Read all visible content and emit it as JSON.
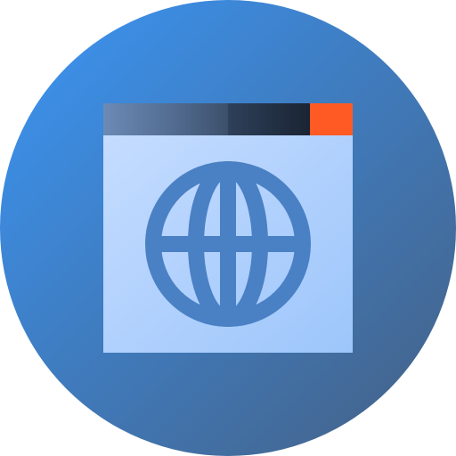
{
  "icon": {
    "name": "browser-globe-icon",
    "colors": {
      "circle_start": "#3a95f5",
      "circle_end": "#456083",
      "titlebar_start": "#6c8bb6",
      "titlebar_mid": "#43597a",
      "titlebar_dark": "#1e2a3a",
      "close_button": "#ff5a24",
      "window_start": "#c5dcff",
      "window_end": "#9dc6fb",
      "globe": "#4a80c4"
    }
  }
}
